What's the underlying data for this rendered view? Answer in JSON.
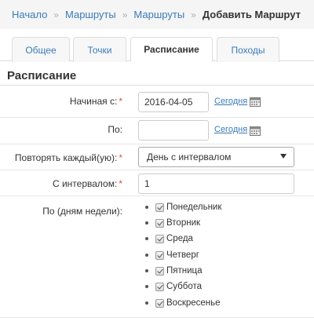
{
  "breadcrumb": {
    "items": [
      "Начало",
      "Маршруты",
      "Маршруты"
    ],
    "separator": "»",
    "current": "Добавить Маршрут"
  },
  "tabs": [
    {
      "label": "Общее",
      "active": false
    },
    {
      "label": "Точки",
      "active": false
    },
    {
      "label": "Расписание",
      "active": true
    },
    {
      "label": "Походы",
      "active": false
    }
  ],
  "section": {
    "title": "Расписание"
  },
  "form": {
    "start_date": {
      "label": "Начиная с:",
      "required_mark": "*",
      "value": "2016-04-05",
      "today_link": "Сегодня"
    },
    "end_date": {
      "label": "По:",
      "value": "",
      "today_link": "Сегодня"
    },
    "repeat": {
      "label": "Повторять каждый(ую):",
      "required_mark": "*",
      "selected": "День с интервалом"
    },
    "interval": {
      "label": "С интервалом:",
      "required_mark": "*",
      "value": "1"
    },
    "weekdays": {
      "label": "По (дням недели):",
      "days": [
        {
          "label": "Понедельник",
          "checked": true
        },
        {
          "label": "Вторник",
          "checked": true
        },
        {
          "label": "Среда",
          "checked": true
        },
        {
          "label": "Четверг",
          "checked": true
        },
        {
          "label": "Пятница",
          "checked": true
        },
        {
          "label": "Суббота",
          "checked": true
        },
        {
          "label": "Воскресенье",
          "checked": true
        }
      ]
    }
  },
  "icons": {
    "calendar": "calendar-icon",
    "dropdown": "chevron-down-icon"
  },
  "colors": {
    "link": "#3a7bb8",
    "required": "#d9534f",
    "breadcrumb_bg": "#f5f5f5"
  }
}
